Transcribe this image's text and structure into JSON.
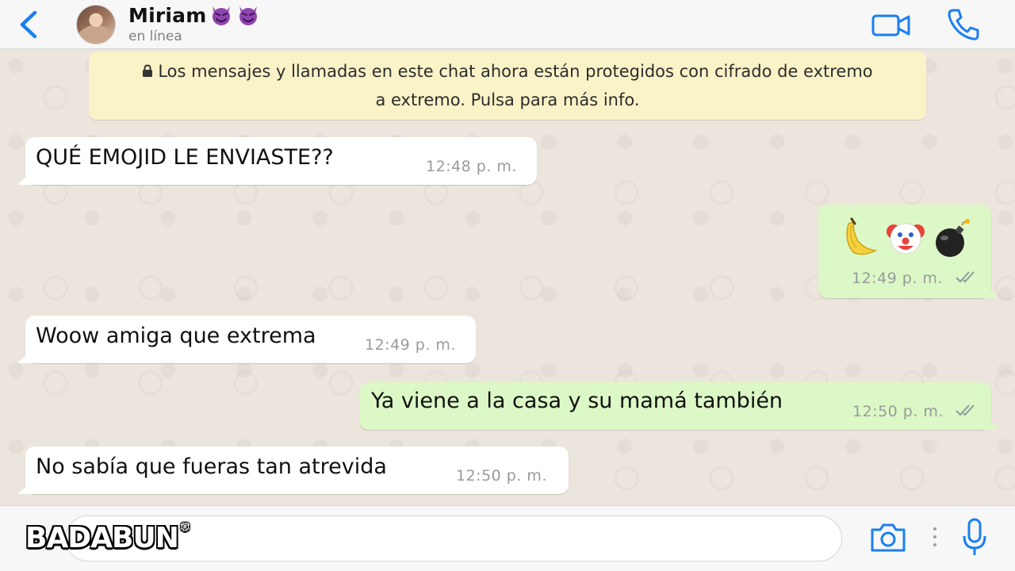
{
  "header": {
    "contact_name": "Miriam",
    "name_emoji": [
      "devil-emoji",
      "devil-emoji"
    ],
    "status": "en línea",
    "icons": [
      "back-chevron-icon",
      "video-call-icon",
      "phone-call-icon"
    ],
    "accent_color": "#1a7ff1"
  },
  "notice": {
    "line1": "Los mensajes y llamadas en este chat ahora están protegidos con cifrado de extremo",
    "line2": "a extremo. Pulsa para más info."
  },
  "messages": [
    {
      "direction": "incoming",
      "text": "QUÉ EMOJID LE ENVIASTE??",
      "time": "12:48 p. m."
    },
    {
      "direction": "outgoing",
      "emojis": [
        "banana-emoji",
        "clown-emoji",
        "bomb-emoji"
      ],
      "time": "12:49 p. m.",
      "read_ticks": "double-check-icon"
    },
    {
      "direction": "incoming",
      "text": "Woow amiga que extrema",
      "time": "12:49 p. m."
    },
    {
      "direction": "outgoing",
      "text": "Ya viene a la casa y su mamá también",
      "time": "12:50 p. m.",
      "read_ticks": "double-check-icon"
    },
    {
      "direction": "incoming",
      "text": "No sabía que fueras tan atrevida",
      "time": "12:50 p. m."
    }
  ],
  "footer": {
    "watermark": "BADABUN",
    "watermark_mark": "®",
    "input_value": "",
    "icons": [
      "camera-icon",
      "more-dots-icon",
      "microphone-icon"
    ]
  },
  "colors": {
    "incoming_bubble": "#ffffff",
    "outgoing_bubble": "#dcf8c6",
    "chat_background": "#ece5dd",
    "notice_background": "#fbf3c8"
  }
}
